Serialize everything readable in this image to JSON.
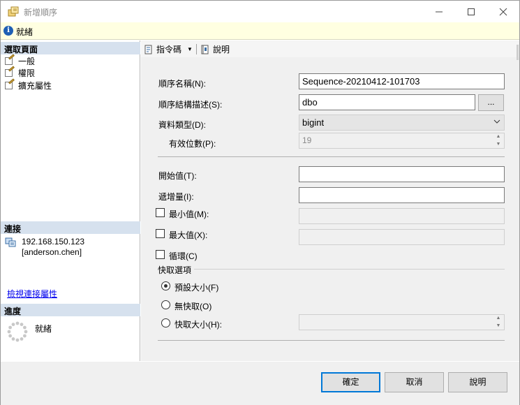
{
  "window": {
    "title": "新增順序"
  },
  "status": {
    "text": "就緒"
  },
  "left": {
    "select_page_header": "選取頁面",
    "pages": [
      {
        "label": "一般",
        "icon": "page-edit-icon"
      },
      {
        "label": "權限",
        "icon": "page-edit-icon"
      },
      {
        "label": "擴充屬性",
        "icon": "page-edit-icon"
      }
    ],
    "connection_header": "連接",
    "server": "192.168.150.123",
    "user": "[anderson.chen]",
    "view_connection_link": "檢視連接屬性",
    "progress_header": "進度",
    "progress_text": "就緒"
  },
  "toolbar": {
    "script_label": "指令碼",
    "help_label": "說明"
  },
  "form": {
    "name_label": "順序名稱(N):",
    "name_value": "Sequence-20210412-101703",
    "schema_label": "順序結構描述(S):",
    "schema_value": "dbo",
    "ellipsis": "...",
    "datatype_label": "資料類型(D):",
    "datatype_value": "bigint",
    "precision_label": "有效位數(P):",
    "precision_value": "19",
    "start_label": "開始值(T):",
    "start_value": "",
    "increment_label": "遞增量(I):",
    "increment_value": "",
    "min_label": "最小值(M):",
    "max_label": "最大值(X):",
    "cycle_label": "循環(C)",
    "cache_group": "快取選項",
    "cache_default": "預設大小(F)",
    "cache_none": "無快取(O)",
    "cache_size": "快取大小(H):",
    "cache_selected": "default"
  },
  "buttons": {
    "ok": "確定",
    "cancel": "取消",
    "help": "說明"
  },
  "colors": {
    "accent": "#0078d7",
    "section_bg": "#d6e1ee",
    "status_bg": "#ffffe1"
  }
}
